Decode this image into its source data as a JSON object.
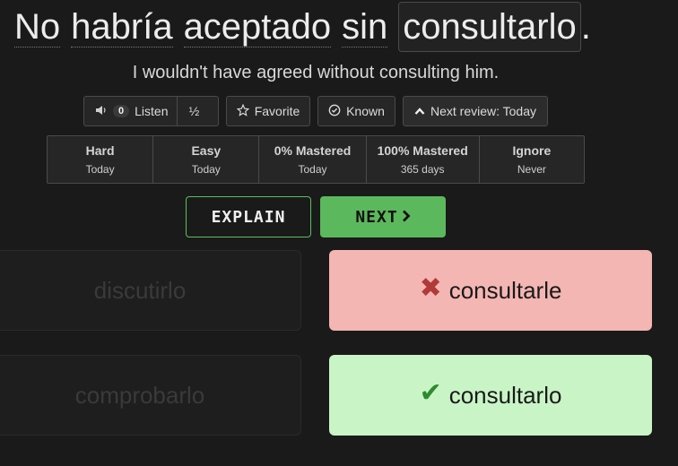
{
  "sentence": {
    "words": [
      "No",
      "habría",
      "aceptado",
      "sin"
    ],
    "answer": "consultarlo",
    "punctuation": "."
  },
  "translation": "I wouldn't have agreed without consulting him.",
  "toolbar": {
    "listen_count": "0",
    "listen_label": "Listen",
    "half_label": "½",
    "favorite_label": "Favorite",
    "known_label": "Known",
    "next_review_label": "Next review: Today"
  },
  "stats": [
    {
      "title": "Hard",
      "sub": "Today"
    },
    {
      "title": "Easy",
      "sub": "Today"
    },
    {
      "title": "0% Mastered",
      "sub": "Today"
    },
    {
      "title": "100% Mastered",
      "sub": "365 days"
    },
    {
      "title": "Ignore",
      "sub": "Never"
    }
  ],
  "actions": {
    "explain_label": "EXPLAIN",
    "next_label": "NEXT"
  },
  "choices": [
    {
      "text": "discutirlo",
      "state": "dim"
    },
    {
      "text": "consultarle",
      "state": "wrong"
    },
    {
      "text": "comprobarlo",
      "state": "dim"
    },
    {
      "text": "consultarlo",
      "state": "correct"
    }
  ],
  "icons": {
    "speaker": "speaker-icon",
    "star": "star-icon",
    "check_circle": "check-circle-icon",
    "chevron_up": "chevron-up-icon",
    "chevron_right": "chevron-right-icon",
    "x_mark": "x-mark-icon",
    "check": "check-icon"
  },
  "colors": {
    "accent_green": "#5cb85c",
    "wrong_bg": "#f4b6b3",
    "correct_bg": "#c9f5c6",
    "wrong_mark": "#b03a3a",
    "correct_mark": "#2e8b2e"
  }
}
